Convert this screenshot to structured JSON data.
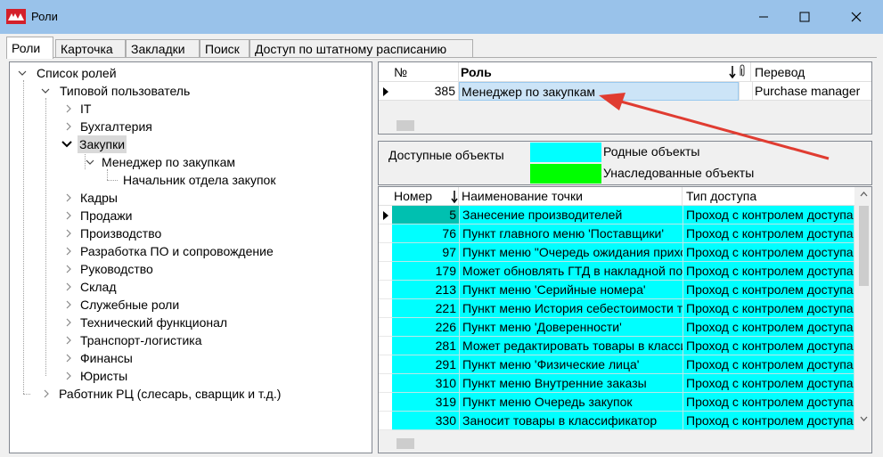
{
  "window": {
    "title": "Роли",
    "accent_color": "#99c2ea",
    "controls": [
      "minimize-icon",
      "maximize-icon",
      "close-icon"
    ]
  },
  "tabs": [
    {
      "label": "Роли",
      "active": true
    },
    {
      "label": "Карточка",
      "active": false
    },
    {
      "label": "Закладки",
      "active": false
    },
    {
      "label": "Поиск",
      "active": false
    },
    {
      "label": "Доступ по штатному расписанию",
      "active": false
    }
  ],
  "tree": {
    "root": "Список ролей",
    "typical_user": "Типовой пользователь",
    "it": "IT",
    "accounting": "Бухгалтерия",
    "purchasing": "Закупки",
    "purchasing_manager": "Менеджер по закупкам",
    "purchasing_head": "Начальник отдела закупок",
    "hr": "Кадры",
    "sales": "Продажи",
    "production": "Производство",
    "software_dev": "Разработка ПО и сопровождение",
    "management": "Руководство",
    "warehouse": "Склад",
    "service_roles": "Служебные роли",
    "technical": "Технический функционал",
    "transport": "Транспорт-логистика",
    "finance": "Финансы",
    "lawyers": "Юристы",
    "dc_worker": "Работник РЦ (слесарь, сварщик и т.д.)",
    "selected": "Закупки"
  },
  "roles_grid": {
    "headers": {
      "num": "№",
      "role": "Роль",
      "translation": "Перевод"
    },
    "row": {
      "num": "385",
      "role": "Менеджер по закупкам",
      "translation": "Purchase manager"
    },
    "sort_icon": "sort-down-arrow-icon",
    "attach_icon": "paperclip-icon"
  },
  "legend": {
    "available_label": "Доступные объекты",
    "native_label": "Родные объекты",
    "native_color": "#00ffff",
    "inherited_label": "Унаследованные объекты",
    "inherited_color": "#00ff00"
  },
  "points_grid": {
    "headers": {
      "num": "Номер",
      "name": "Наименование точки",
      "access": "Тип доступа"
    },
    "rows": [
      {
        "num": "5",
        "name": "Занесение производителей",
        "access": "Проход с контролем доступа"
      },
      {
        "num": "76",
        "name": "Пункт главного меню 'Поставщики'",
        "access": "Проход с контролем доступа"
      },
      {
        "num": "97",
        "name": "Пункт меню \"Очередь ожидания прихода\"",
        "access": "Проход с контролем доступа"
      },
      {
        "num": "179",
        "name": "Может обновлять ГТД в накладной по приходу",
        "access": "Проход с контролем доступа"
      },
      {
        "num": "213",
        "name": "Пункт меню 'Серийные номера'",
        "access": "Проход с контролем доступа"
      },
      {
        "num": "221",
        "name": "Пункт меню История себестоимости товара",
        "access": "Проход с контролем доступа"
      },
      {
        "num": "226",
        "name": "Пункт меню 'Доверенности'",
        "access": "Проход с контролем доступа"
      },
      {
        "num": "281",
        "name": "Может редактировать товары в классификаторе",
        "access": "Проход с контролем доступа"
      },
      {
        "num": "291",
        "name": "Пункт меню 'Физические лица'",
        "access": "Проход с контролем доступа"
      },
      {
        "num": "310",
        "name": "Пункт меню Внутренние заказы",
        "access": "Проход с контролем доступа"
      },
      {
        "num": "319",
        "name": "Пункт меню Очередь закупок",
        "access": "Проход с контролем доступа"
      },
      {
        "num": "330",
        "name": "Заносит товары в классификатор",
        "access": "Проход с контролем доступа"
      }
    ],
    "row_color": "#00ffff",
    "selected_num_color": "#00c0b0"
  },
  "annotation": {
    "arrow_color": "#e03c31"
  }
}
